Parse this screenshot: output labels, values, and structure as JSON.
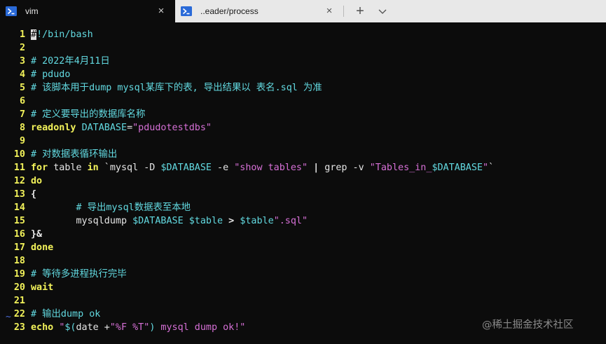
{
  "tabs": [
    {
      "label": "vim",
      "active": true,
      "icon": "powershell-icon"
    },
    {
      "label": "..eader/process",
      "active": false,
      "icon": "powershell-icon"
    }
  ],
  "tab_controls": {
    "new_tab": "+",
    "dropdown": "chevron-down-icon",
    "close": "×"
  },
  "colors": {
    "line_number": "#f2f25a",
    "comment": "#62d9e0",
    "string": "#d670d6",
    "keyword": "#f2f25a",
    "background": "#0c0c0c"
  },
  "editor": {
    "lines": [
      {
        "n": "1",
        "segs": [
          {
            "t": "#",
            "c": "cursor"
          },
          {
            "t": "!/bin/bash",
            "c": "comment"
          }
        ]
      },
      {
        "n": "2",
        "segs": []
      },
      {
        "n": "3",
        "segs": [
          {
            "t": "# 2022年4月11日",
            "c": "comment"
          }
        ]
      },
      {
        "n": "4",
        "segs": [
          {
            "t": "# pdudo",
            "c": "comment"
          }
        ]
      },
      {
        "n": "5",
        "segs": [
          {
            "t": "# 该脚本用于dump mysql某库下的表, 导出结果以 表名.sql 为准",
            "c": "comment"
          }
        ]
      },
      {
        "n": "6",
        "segs": []
      },
      {
        "n": "7",
        "segs": [
          {
            "t": "# 定义要导出的数据库名称",
            "c": "comment"
          }
        ]
      },
      {
        "n": "8",
        "segs": [
          {
            "t": "readonly ",
            "c": "keyword"
          },
          {
            "t": "DATABASE",
            "c": "var"
          },
          {
            "t": "=",
            "c": "default"
          },
          {
            "t": "\"pdudotestdbs\"",
            "c": "string"
          }
        ]
      },
      {
        "n": "9",
        "segs": []
      },
      {
        "n": "10",
        "segs": [
          {
            "t": "# 对数据表循环输出",
            "c": "comment"
          }
        ]
      },
      {
        "n": "11",
        "segs": [
          {
            "t": "for",
            "c": "keyword"
          },
          {
            "t": " table ",
            "c": "default"
          },
          {
            "t": "in",
            "c": "keyword"
          },
          {
            "t": " `mysql -D ",
            "c": "default"
          },
          {
            "t": "$DATABASE",
            "c": "var"
          },
          {
            "t": " -e ",
            "c": "default"
          },
          {
            "t": "\"show tables\"",
            "c": "string"
          },
          {
            "t": " | ",
            "c": "op"
          },
          {
            "t": "grep -v ",
            "c": "default"
          },
          {
            "t": "\"Tables_in_",
            "c": "string"
          },
          {
            "t": "$DATABASE",
            "c": "var"
          },
          {
            "t": "\"",
            "c": "string"
          },
          {
            "t": "`",
            "c": "default"
          }
        ]
      },
      {
        "n": "12",
        "segs": [
          {
            "t": "do",
            "c": "keyword"
          }
        ]
      },
      {
        "n": "13",
        "segs": [
          {
            "t": "{",
            "c": "op"
          }
        ]
      },
      {
        "n": "14",
        "segs": [
          {
            "t": "        # 导出mysql数据表至本地",
            "c": "comment"
          }
        ]
      },
      {
        "n": "15",
        "segs": [
          {
            "t": "        mysqldump ",
            "c": "default"
          },
          {
            "t": "$DATABASE",
            "c": "var"
          },
          {
            "t": " ",
            "c": "default"
          },
          {
            "t": "$table",
            "c": "var"
          },
          {
            "t": " > ",
            "c": "op"
          },
          {
            "t": "$table",
            "c": "var"
          },
          {
            "t": "\".sql\"",
            "c": "string"
          }
        ]
      },
      {
        "n": "16",
        "segs": [
          {
            "t": "}&",
            "c": "op"
          }
        ]
      },
      {
        "n": "17",
        "segs": [
          {
            "t": "done",
            "c": "keyword"
          }
        ]
      },
      {
        "n": "18",
        "segs": []
      },
      {
        "n": "19",
        "segs": [
          {
            "t": "# 等待多进程执行完毕",
            "c": "comment"
          }
        ]
      },
      {
        "n": "20",
        "segs": [
          {
            "t": "wait",
            "c": "keyword"
          }
        ]
      },
      {
        "n": "21",
        "segs": []
      },
      {
        "n": "22",
        "segs": [
          {
            "t": "# 输出dump ok",
            "c": "comment"
          }
        ]
      },
      {
        "n": "23",
        "segs": [
          {
            "t": "echo ",
            "c": "keyword"
          },
          {
            "t": "\"",
            "c": "string"
          },
          {
            "t": "$(",
            "c": "var"
          },
          {
            "t": "date +",
            "c": "default"
          },
          {
            "t": "\"%F %T\"",
            "c": "string"
          },
          {
            "t": ")",
            "c": "var"
          },
          {
            "t": " mysql dump ok!\"",
            "c": "string"
          }
        ]
      }
    ],
    "tilde": "~"
  },
  "watermark": "@稀土掘金技术社区"
}
